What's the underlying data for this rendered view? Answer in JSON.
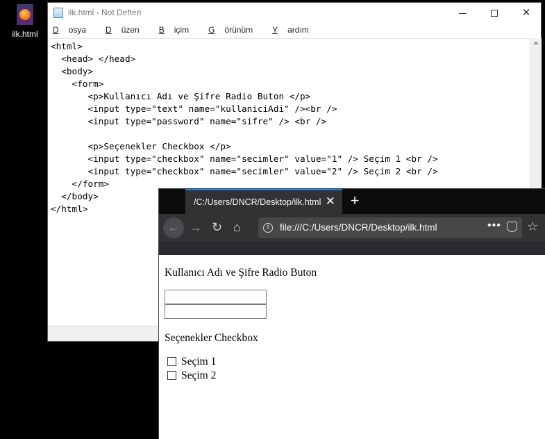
{
  "desktop": {
    "icon_label": "ilk.html"
  },
  "notepad": {
    "title": "ilk.html - Not Defteri",
    "menu": [
      {
        "u": "D",
        "rest": "osya"
      },
      {
        "u": "D",
        "rest": "üzen"
      },
      {
        "u": "B",
        "rest": "içim"
      },
      {
        "u": "G",
        "rest": "örünüm"
      },
      {
        "u": "Y",
        "rest": "ardım"
      }
    ],
    "code_lines": [
      "<html>",
      "  <head> </head>",
      "  <body>",
      "    <form>",
      "       <p>Kullanıcı Adı ve Şifre Radio Buton </p>",
      "       <input type=\"text\" name=\"kullaniciAdi\" /><br />",
      "       <input type=\"password\" name=\"sifre\" /> <br />",
      "",
      "       <p>Seçenekler Checkbox </p>",
      "       <input type=\"checkbox\" name=\"secimler\" value=\"1\" /> Seçim 1 <br />",
      "       <input type=\"checkbox\" name=\"secimler\" value=\"2\" /> Seçim 2 <br />",
      "    </form>",
      "  </body>",
      "</html>"
    ]
  },
  "firefox": {
    "tab_title": "/C:/Users/DNCR/Desktop/ilk.html",
    "tab_close": "✕",
    "new_tab": "+",
    "url": "file:///C:/Users/DNCR/Desktop/ilk.html",
    "page": {
      "heading1": "Kullanıcı Adı ve Şifre Radio Buton",
      "heading2": "Seçenekler Checkbox",
      "checkbox1_label": "Seçim 1",
      "checkbox2_label": "Seçim 2"
    }
  },
  "colors": {
    "tab_accent": "#0a84ff",
    "ff_dark": "#323234"
  }
}
